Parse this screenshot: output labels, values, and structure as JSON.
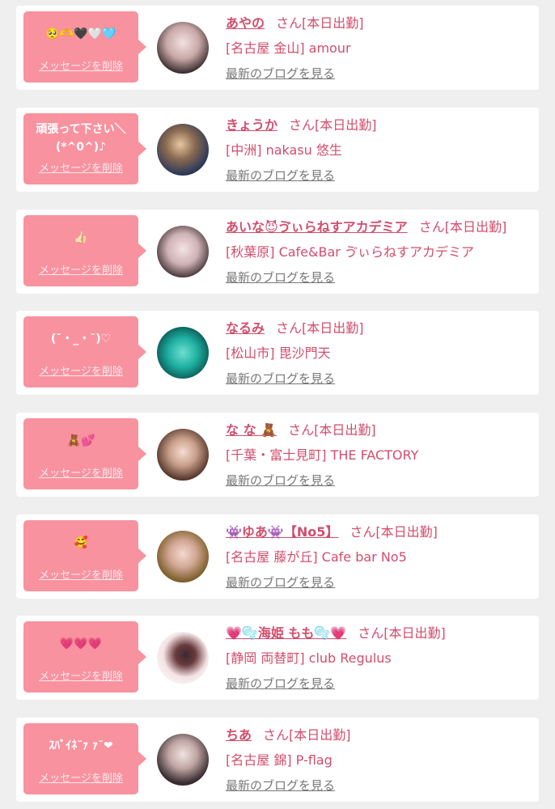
{
  "colors": {
    "bubble": "#f8929f",
    "accent": "#d24d6c",
    "background": "#efefef",
    "card": "#ffffff"
  },
  "entries": [
    {
      "message": "🥺🫶🖤🤍🩵",
      "delete_label": "メッセージを削除",
      "name": "あやの",
      "honorific": "さん",
      "status": "[本日出勤]",
      "shop": "[名古屋 金山] amour",
      "blog_link": "最新のブログを見る",
      "avatar": "photo"
    },
    {
      "message": "頑張って下さい＼\n(*^0^)♪",
      "delete_label": "メッセージを削除",
      "name": "きょうか",
      "honorific": "さん",
      "status": "[本日出勤]",
      "shop": "[中洲] nakasu 悠生",
      "blog_link": "最新のブログを見る",
      "avatar": "photo"
    },
    {
      "message": "👍🏻",
      "delete_label": "メッセージを削除",
      "name": "あいな😈ゔぃらねすアカデミア",
      "honorific": "さん",
      "status": "[本日出勤]",
      "shop": "[秋葉原] Cafe&Bar ゔぃらねすアカデミア",
      "blog_link": "最新のブログを見る",
      "avatar": "photo"
    },
    {
      "message": "(˘・_・˘)♡",
      "delete_label": "メッセージを削除",
      "name": "なるみ",
      "honorific": "さん",
      "status": "[本日出勤]",
      "shop": "[松山市] 毘沙門天",
      "blog_link": "最新のブログを見る",
      "avatar": "photo"
    },
    {
      "message": "🧸💕",
      "delete_label": "メッセージを削除",
      "name": "な な 🧸",
      "honorific": "さん",
      "status": "[本日出勤]",
      "shop": "[千葉・富士見町] THE FACTORY",
      "blog_link": "最新のブログを見る",
      "avatar": "photo"
    },
    {
      "message": "🥰",
      "delete_label": "メッセージを削除",
      "name": "👾ゆあ👾【No5】",
      "honorific": "さん",
      "status": "[本日出勤]",
      "shop": "[名古屋 藤が丘] Cafe bar No5",
      "blog_link": "最新のブログを見る",
      "avatar": "photo"
    },
    {
      "message": "💗💗💗",
      "delete_label": "メッセージを削除",
      "name": "💗🫧海姫 もも🫧💗",
      "honorific": "さん",
      "status": "[本日出勤]",
      "shop": "[静岡 両替町] club Regulus",
      "blog_link": "最新のブログを見る",
      "avatar": "photo"
    },
    {
      "message": "ｽﾊﾞｲﾈ˘ｧ ｧ˘❤",
      "delete_label": "メッセージを削除",
      "name": "ちあ",
      "honorific": "さん",
      "status": "[本日出勤]",
      "shop": "[名古屋 錦] P-flag",
      "blog_link": "最新のブログを見る",
      "avatar": "photo"
    }
  ]
}
